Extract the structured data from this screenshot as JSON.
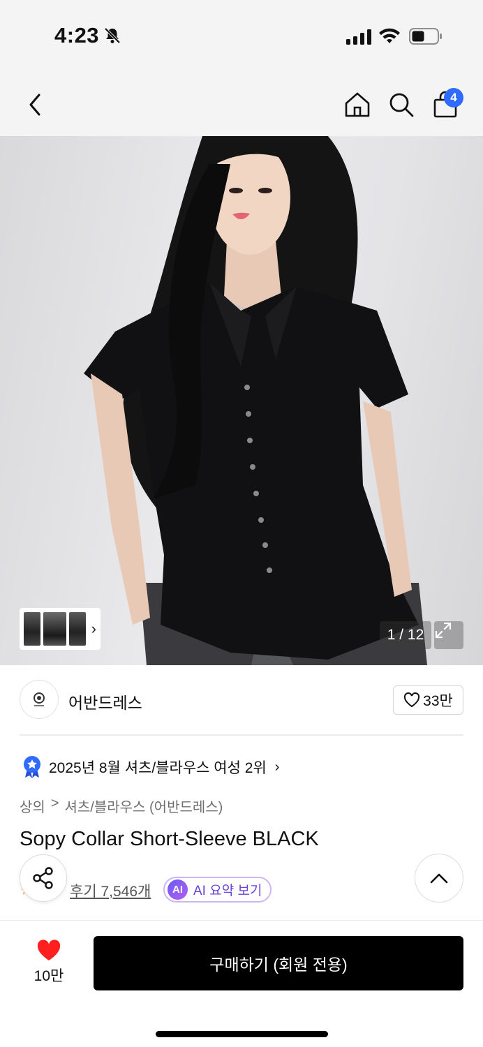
{
  "status_bar": {
    "time": "4:23"
  },
  "nav": {
    "cart_count": "4"
  },
  "gallery": {
    "counter": "1 / 12"
  },
  "brand": {
    "name": "어반드레스",
    "likes": "33만"
  },
  "ranking": {
    "text": "2025년 8월 셔츠/블라우스 여성 2위"
  },
  "breadcrumb": {
    "level1": "상의",
    "separator": ">",
    "level2": "셔츠/블라우스 (어반드레스)"
  },
  "product": {
    "title": "Sopy Collar Short-Sleeve BLACK"
  },
  "reviews": {
    "text": "후기 7,546개",
    "ai_badge": "AI",
    "ai_label": "AI 요약 보기"
  },
  "bottom": {
    "wish_count": "10만",
    "buy_label": "구매하기 (회원 전용)"
  },
  "colors": {
    "accent_blue": "#2f6bff",
    "heart_red": "#ff1f1f",
    "ai_purple": "#6a42d8",
    "buy_button": "#000000"
  }
}
